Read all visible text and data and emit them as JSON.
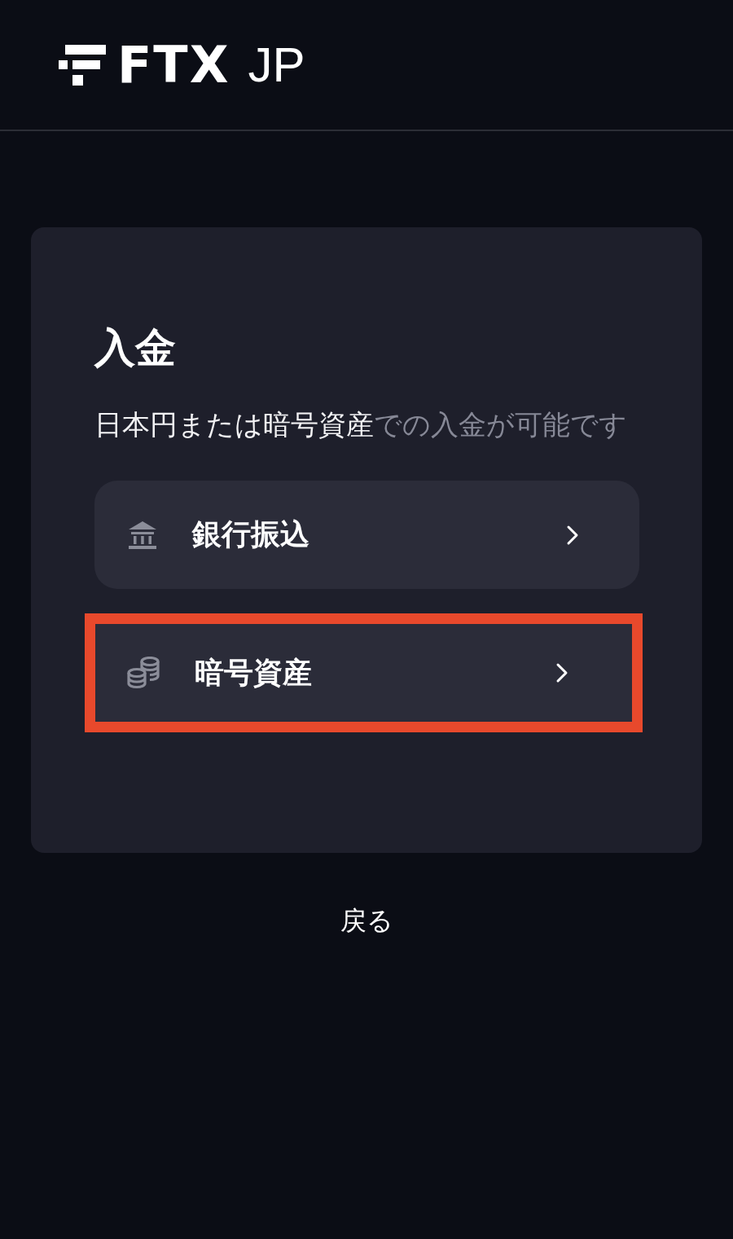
{
  "header": {
    "logo_main": "FTX",
    "logo_suffix": "JP"
  },
  "card": {
    "title": "入金",
    "description": {
      "highlight": "日本円または暗号資産",
      "rest": "での入金が可能です"
    },
    "options": [
      {
        "kind": "bank",
        "label": "銀行振込",
        "highlighted": false
      },
      {
        "kind": "crypto",
        "label": "暗号資産",
        "highlighted": true
      }
    ]
  },
  "back_link": "戻る"
}
